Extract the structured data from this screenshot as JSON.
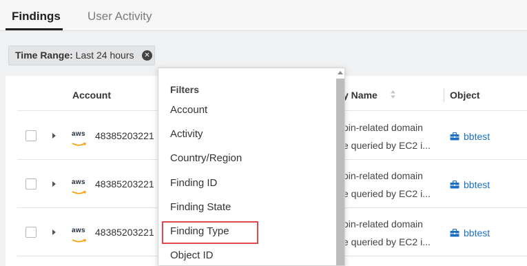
{
  "tabs": [
    {
      "label": "Findings",
      "active": true
    },
    {
      "label": "User Activity",
      "active": false
    }
  ],
  "filter_chip": {
    "key": "Time Range:",
    "value": "Last 24 hours",
    "close_icon": "close-circle-icon"
  },
  "table": {
    "columns": {
      "account": "Account",
      "name": "y Name",
      "object": "Object"
    },
    "rows": [
      {
        "logo": "aws",
        "account": "48385203221",
        "desc_line1": "oin-related domain",
        "desc_line2": "e queried by EC2 i...",
        "object": "bbtest"
      },
      {
        "logo": "aws",
        "account": "48385203221",
        "desc_line1": "oin-related domain",
        "desc_line2": "e queried by EC2 i...",
        "object": "bbtest"
      },
      {
        "logo": "aws",
        "account": "48385203221",
        "desc_line1": "oin-related domain",
        "desc_line2": "e queried by EC2 i...",
        "object": "bbtest"
      }
    ]
  },
  "dropdown": {
    "heading": "Filters",
    "items": [
      "Account",
      "Activity",
      "Country/Region",
      "Finding ID",
      "Finding State",
      "Finding Type",
      "Object ID"
    ],
    "highlighted_item": "Finding Type"
  },
  "colors": {
    "link": "#1a6fc2",
    "highlight_border": "#e0474c"
  }
}
